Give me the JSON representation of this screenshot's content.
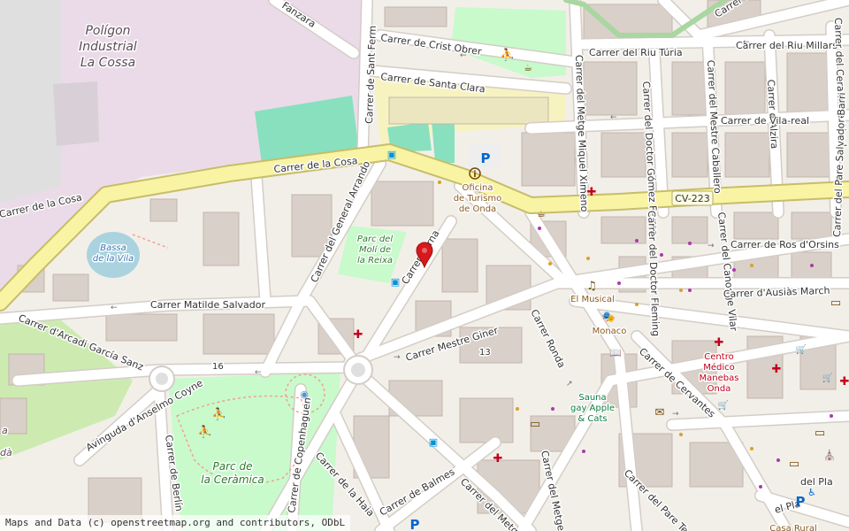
{
  "colors": {
    "background": "#f2efe9",
    "industrial": "#ebdbe8",
    "residential": "#e0dfdf",
    "park": "#c8facc",
    "pitch": "#88e0be",
    "water": "#aad3df",
    "primary_road": "#f8f4a4",
    "primary_casing": "#c7bd6a",
    "minor_road": "#ffffff",
    "marker": "#d7191c"
  },
  "areas": {
    "industrial_name_1": "Polígon",
    "industrial_name_2": "Industrial",
    "industrial_name_3": "La Cossa",
    "pond_1": "Bassa",
    "pond_2": "de la Vila",
    "park_molí_1": "Parc del",
    "park_molí_2": "Molí de",
    "park_molí_3": "la Reixa",
    "park_ceramica_1": "Parc de",
    "park_ceramica_2": "la Ceràmica",
    "edge_1": "a",
    "edge_2": "dà"
  },
  "streets": [
    {
      "text": "Fanzara"
    },
    {
      "text": "Carrer de Sant Ferm"
    },
    {
      "text": "Carrer de Crist Obrer"
    },
    {
      "text": "Carrer de Santa Clara"
    },
    {
      "text": "Carrer del Riu Túria"
    },
    {
      "text": "Carrer del Riu Millars"
    },
    {
      "text": "Carrer del Metge Miquel Ximeno"
    },
    {
      "text": "Carrer del Doctor Gómez Ferrer"
    },
    {
      "text": "Carrer del Mestre Caballero"
    },
    {
      "text": "Carrer d'Alzira"
    },
    {
      "text": "Carrer del Ceramista Abad"
    },
    {
      "text": "Carrer de Vila-real"
    },
    {
      "text": "Carrer de la Cosa"
    },
    {
      "text": "Carrer de la Cosa"
    },
    {
      "text": "Carrer del General Arrando"
    },
    {
      "text": "Carrer Serna"
    },
    {
      "text": "Carrer Matilde Salvador"
    },
    {
      "text": "Carrer d'Arcadi García Sanz"
    },
    {
      "text": "Avinguda d'Anselmo Coyne"
    },
    {
      "text": "Carrer Mestre Giner"
    },
    {
      "text": "Carrer Ronda"
    },
    {
      "text": "Carrer del Doctor Fleming"
    },
    {
      "text": "Carrer del Canonge Vilar"
    },
    {
      "text": "Carrer del Pare Salvador Barri"
    },
    {
      "text": "Carrer de Ros d'Orsins"
    },
    {
      "text": "Carrer d'Ausiàs March"
    },
    {
      "text": "Carrer de Cervantes"
    },
    {
      "text": "Carrer de Copenhaguen"
    },
    {
      "text": "Carrer de Berlín"
    },
    {
      "text": "Carrer de la Haia"
    },
    {
      "text": "Carrer de Balmes"
    },
    {
      "text": "Carrer del Metge"
    },
    {
      "text": "Carrer del Metge Ric"
    },
    {
      "text": "Carrer del Pare Te"
    },
    {
      "text": "del Pla"
    },
    {
      "text": "el Pla"
    },
    {
      "text": "Carrer del"
    }
  ],
  "road_ref": "CV-223",
  "house_numbers": [
    "16",
    "13"
  ],
  "pois": {
    "tourism_1": "Oficina",
    "tourism_2": "de Turismo",
    "tourism_3": "de Onda",
    "musical": "El Musical",
    "monaco": "Monaco",
    "sauna_1": "Sauna",
    "sauna_2": "gay Apple",
    "sauna_3": "& Cats",
    "clinic_1": "Centro",
    "clinic_2": "Médico",
    "clinic_3": "Manebas",
    "clinic_4": "Onda",
    "bottom_right": "Casa Rural"
  },
  "icons": [
    {
      "name": "parking-icon",
      "glyph": "P"
    },
    {
      "name": "parking-icon",
      "glyph": "P"
    },
    {
      "name": "parking-icon",
      "glyph": "P"
    },
    {
      "name": "info-icon",
      "glyph": "i"
    },
    {
      "name": "pharmacy-icon",
      "glyph": "✚"
    },
    {
      "name": "pharmacy-icon",
      "glyph": "✚"
    },
    {
      "name": "pharmacy-icon",
      "glyph": "✚"
    },
    {
      "name": "pharmacy-icon",
      "glyph": "✚"
    },
    {
      "name": "pharmacy-icon",
      "glyph": "✚"
    },
    {
      "name": "pharmacy-icon",
      "glyph": "✚"
    },
    {
      "name": "theatre-icon",
      "glyph": "🎭"
    },
    {
      "name": "music-icon",
      "glyph": "♫"
    },
    {
      "name": "book-icon",
      "glyph": "📖"
    },
    {
      "name": "post-icon",
      "glyph": "✉"
    },
    {
      "name": "atm-icon",
      "glyph": "▭"
    },
    {
      "name": "atm-icon",
      "glyph": "▭"
    },
    {
      "name": "atm-icon",
      "glyph": "▭"
    },
    {
      "name": "atm-icon",
      "glyph": "▭"
    },
    {
      "name": "cart-icon",
      "glyph": "🛒"
    },
    {
      "name": "cart-icon",
      "glyph": "🛒"
    },
    {
      "name": "cart-icon",
      "glyph": "🛒"
    },
    {
      "name": "bus-stop-icon",
      "glyph": "▣"
    },
    {
      "name": "bus-stop-icon",
      "glyph": "▣"
    },
    {
      "name": "bus-stop-icon",
      "glyph": "▣"
    },
    {
      "name": "playground-icon",
      "glyph": "⛹"
    },
    {
      "name": "playground-icon",
      "glyph": "⛹"
    },
    {
      "name": "playground-icon",
      "glyph": "⛹"
    },
    {
      "name": "cafe-icon",
      "glyph": "☕"
    },
    {
      "name": "cafe-icon",
      "glyph": "☕"
    },
    {
      "name": "fountain-icon",
      "glyph": "◉"
    },
    {
      "name": "church-icon",
      "glyph": "⛪"
    },
    {
      "name": "wheelchair-icon",
      "glyph": "♿"
    }
  ],
  "attribution": "Maps and Data (c) openstreetmap.org and contributors, ODbL"
}
